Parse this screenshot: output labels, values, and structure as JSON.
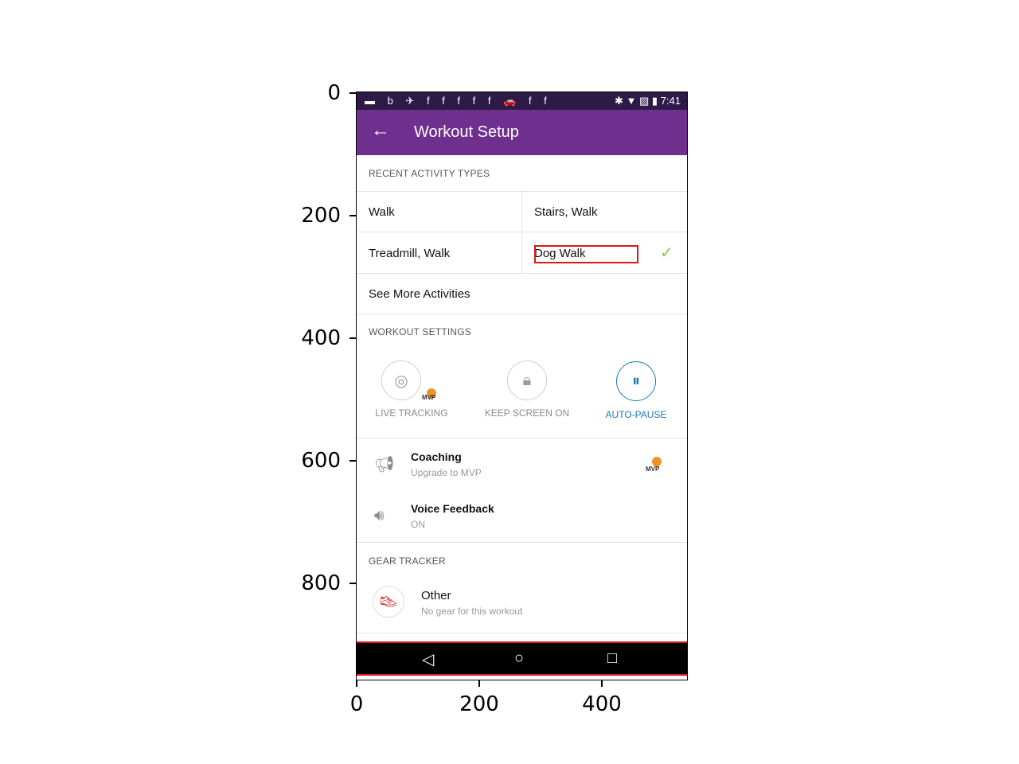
{
  "axes": {
    "y_ticks": [
      "0",
      "200",
      "400",
      "600",
      "800"
    ],
    "x_ticks": [
      "0",
      "200",
      "400"
    ]
  },
  "status_bar": {
    "left_icons": "▬ b ✈ f f f f f 🚗 f f",
    "right": "✱ ▼ ▨ ▮ 7:41"
  },
  "app_bar": {
    "title": "Workout Setup",
    "back_icon": "←"
  },
  "recent_activity": {
    "header": "RECENT ACTIVITY TYPES",
    "items": [
      "Walk",
      "Stairs, Walk",
      "Treadmill, Walk",
      "Dog Walk"
    ],
    "see_more": "See More Activities",
    "selected_check": "✓"
  },
  "workout_settings": {
    "header": "WORKOUT SETTINGS",
    "live_tracking": "LIVE TRACKING",
    "keep_screen_on": "KEEP SCREEN ON",
    "auto_pause": "AUTO-PAUSE",
    "mvp": "MVP",
    "accent_color": "#1b78b8"
  },
  "coaching": {
    "title": "Coaching",
    "subtitle": "Upgrade to MVP",
    "mvp": "MVP"
  },
  "voice_feedback": {
    "title": "Voice Feedback",
    "subtitle": "ON"
  },
  "gear_tracker": {
    "header": "GEAR TRACKER",
    "title": "Other",
    "subtitle": "No gear for this workout"
  },
  "nav_bar": {
    "back": "◁",
    "home": "○",
    "recents": "□"
  },
  "colors": {
    "app_bar": "#6e2f8f",
    "status_bar": "#2e1a47",
    "check": "#8bc34a",
    "annotation": "#e01515"
  }
}
